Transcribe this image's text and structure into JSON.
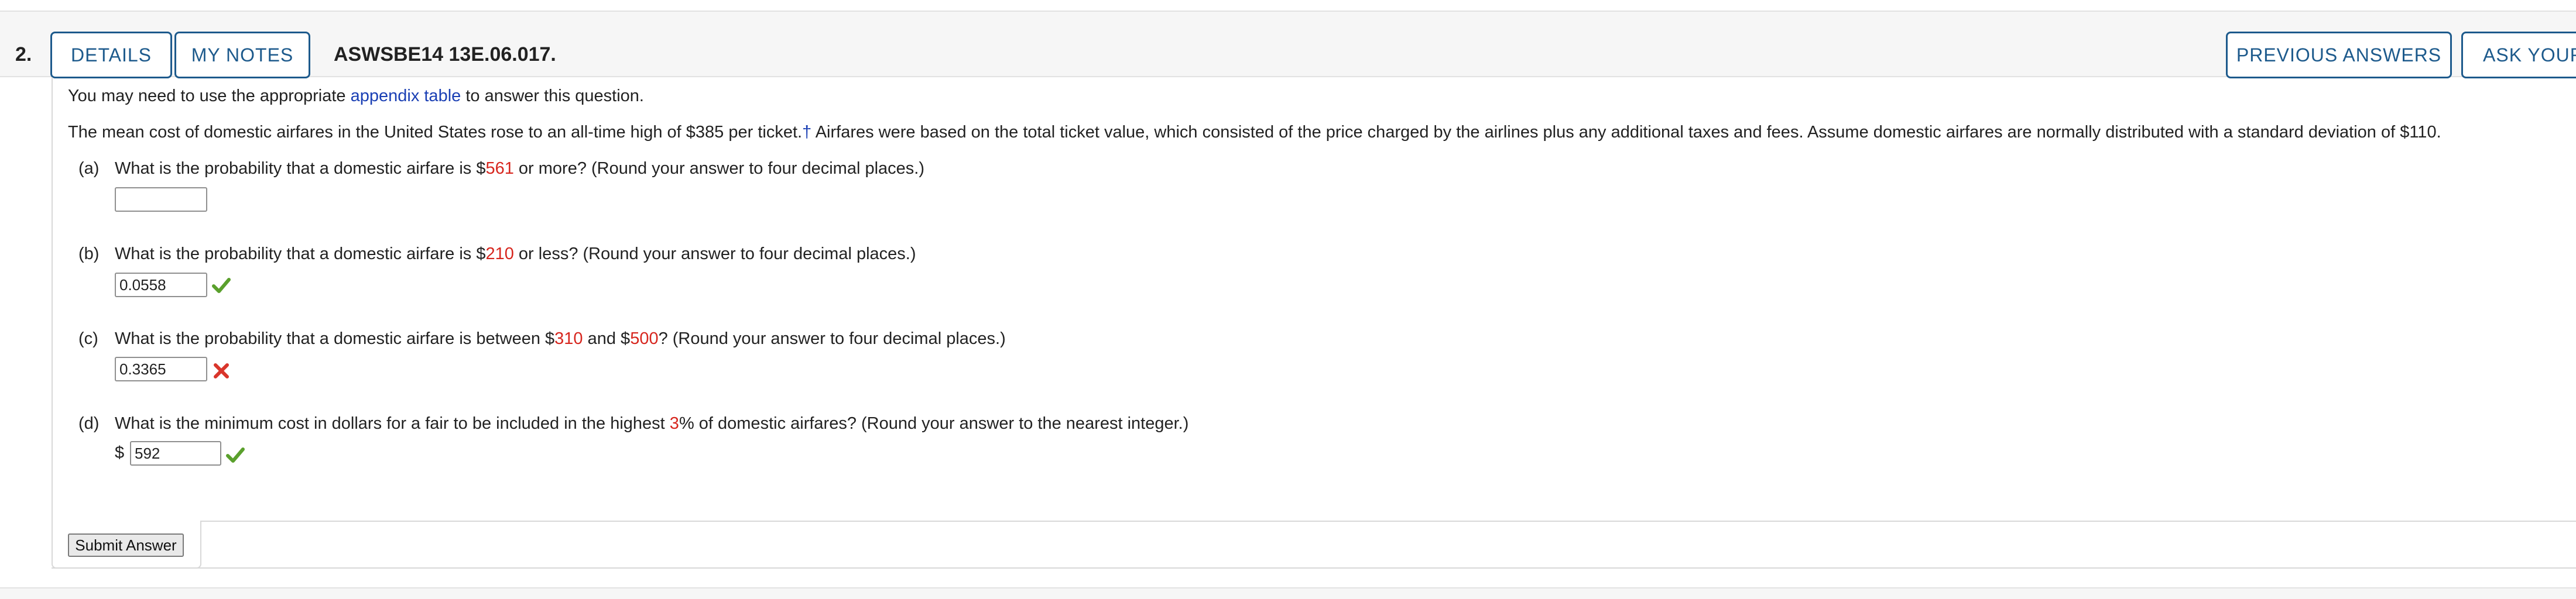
{
  "header": {
    "question_number": "2.",
    "details_label": "DETAILS",
    "my_notes_label": "MY NOTES",
    "question_id": "ASWSBE14 13E.06.017.",
    "previous_answers_label": "PREVIOUS ANSWERS",
    "ask_label": "ASK YOUR"
  },
  "intro": {
    "before_link": "You may need to use the appropriate ",
    "link_text": "appendix table",
    "after_link": " to answer this question."
  },
  "stem": {
    "part1": "The mean cost of domestic airfares in the United States rose to an all-time high of $385 per ticket.",
    "dagger": "†",
    "part2": " Airfares were based on the total ticket value, which consisted of the price charged by the airlines plus any additional taxes and fees. Assume domestic airfares are normally distributed with a standard deviation of $110."
  },
  "parts": {
    "a": {
      "label": "(a)",
      "pre": "What is the probability that a domestic airfare is $",
      "value": "561",
      "post": " or more? (Round your answer to four decimal places.)",
      "answer": "",
      "status": "unanswered"
    },
    "b": {
      "label": "(b)",
      "pre": "What is the probability that a domestic airfare is $",
      "value": "210",
      "post": " or less? (Round your answer to four decimal places.)",
      "answer": "0.0558",
      "status": "correct"
    },
    "c": {
      "label": "(c)",
      "pre": "What is the probability that a domestic airfare is between $",
      "value1": "310",
      "mid": " and $",
      "value2": "500",
      "post": "? (Round your answer to four decimal places.)",
      "answer": "0.3365",
      "status": "incorrect"
    },
    "d": {
      "label": "(d)",
      "pre": "What is the minimum cost in dollars for a fair to be included in the highest ",
      "value": "3",
      "post": "% of domestic airfares? (Round your answer to the nearest integer.)",
      "currency": "$",
      "answer": "592",
      "status": "correct"
    }
  },
  "submit_label": "Submit Answer",
  "colors": {
    "accent": "#1d5a8c",
    "link": "#1a3fb4",
    "highlight": "#d7261e",
    "correct": "#5aa02c",
    "incorrect": "#d9352b"
  },
  "icons": {
    "correct": "check-icon",
    "incorrect": "x-icon"
  }
}
